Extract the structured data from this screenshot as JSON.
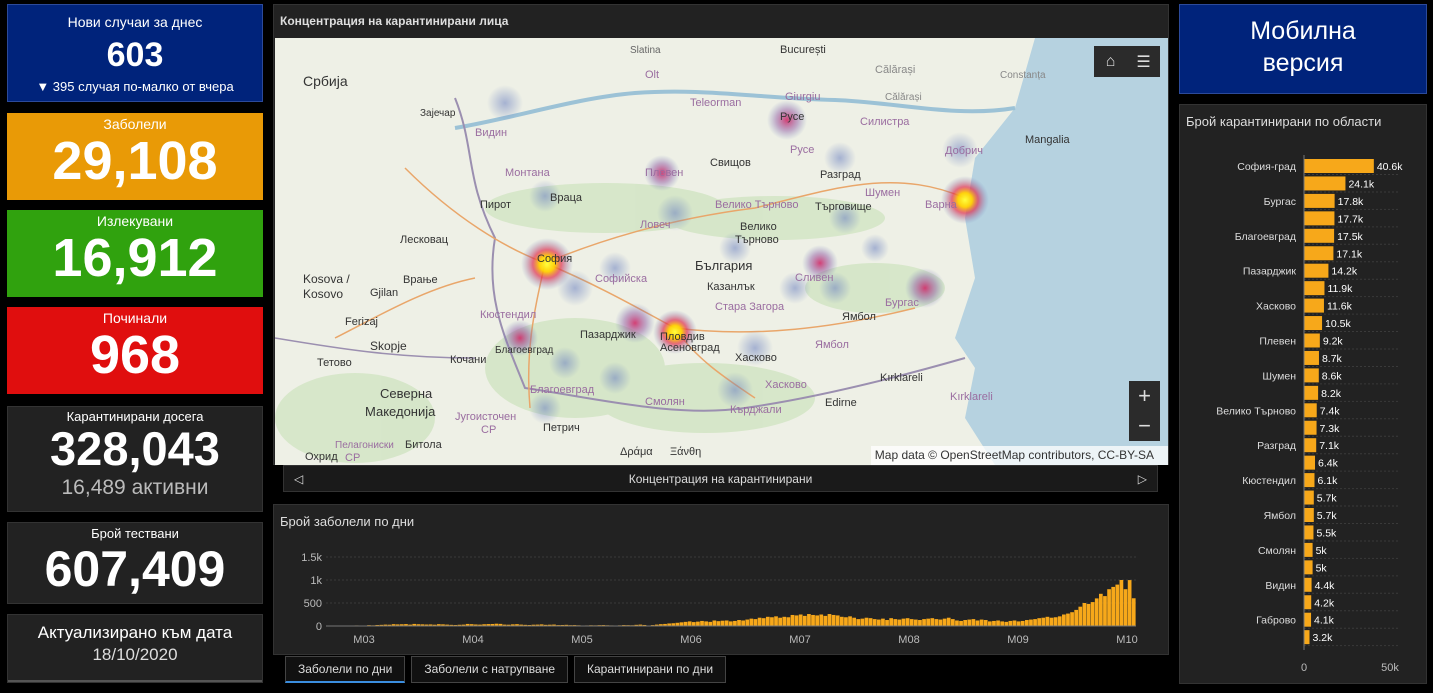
{
  "new_cases": {
    "label": "Нови случаи за днес",
    "value": "603",
    "delta": "▼ 395 случая по-малко от вчера"
  },
  "ill": {
    "label": "Заболели",
    "value": "29,108"
  },
  "recovered": {
    "label": "Излекувани",
    "value": "16,912"
  },
  "deceased": {
    "label": "Починали",
    "value": "968"
  },
  "quarantined": {
    "label": "Карантинирани досега",
    "value": "328,043",
    "active": "16,489 активни"
  },
  "tests": {
    "label": "Брой тествани",
    "value": "607,409"
  },
  "updated": {
    "label": "Актуализирано към дата",
    "date": "18/10/2020"
  },
  "mobile": {
    "line1": "Мобилна",
    "line2": "версия"
  },
  "map": {
    "title": "Концентрация на карантинирани лица",
    "attribution": "Map data © OpenStreetMap contributors, CC-BY-SA",
    "nav_label": "Концентрация на карантинирани",
    "home_icon": "home-icon",
    "list_icon": "list-icon",
    "zoom_in": "+",
    "zoom_out": "−",
    "labels": [
      {
        "t": "Slatina"
      },
      {
        "t": "București"
      },
      {
        "t": "Călărași"
      },
      {
        "t": "Constanța"
      },
      {
        "t": "Olt"
      },
      {
        "t": "Giurgiu"
      },
      {
        "t": "Teleorman"
      },
      {
        "t": "Călărași"
      },
      {
        "t": "Србија"
      },
      {
        "t": "Зајечар"
      },
      {
        "t": "Видин"
      },
      {
        "t": "Русе"
      },
      {
        "t": "Силистра"
      },
      {
        "t": "Mangalia"
      },
      {
        "t": "Добрич"
      },
      {
        "t": "Монтана"
      },
      {
        "t": "Плевен"
      },
      {
        "t": "Свищов"
      },
      {
        "t": "Русе"
      },
      {
        "t": "Разград"
      },
      {
        "t": "Шумен"
      },
      {
        "t": "Варна"
      },
      {
        "t": "Враца"
      },
      {
        "t": "Велико Търново"
      },
      {
        "t": "Търговище"
      },
      {
        "t": "Пирот"
      },
      {
        "t": "Ловеч"
      },
      {
        "t": "Велико"
      },
      {
        "t": "Търново"
      },
      {
        "t": "Лесковац"
      },
      {
        "t": "София"
      },
      {
        "t": "Софийска"
      },
      {
        "t": "България"
      },
      {
        "t": "Сливен"
      },
      {
        "t": "Казанлък"
      },
      {
        "t": "Стара Загора"
      },
      {
        "t": "Ямбол"
      },
      {
        "t": "Бургас"
      },
      {
        "t": "Врање"
      },
      {
        "t": "Kosova /"
      },
      {
        "t": "Kosovo"
      },
      {
        "t": "Gjilan"
      },
      {
        "t": "Кюстендил"
      },
      {
        "t": "Пазарджик"
      },
      {
        "t": "Пловдив"
      },
      {
        "t": "Асеновград"
      },
      {
        "t": "Хасково"
      },
      {
        "t": "Ямбол"
      },
      {
        "t": "Ferizaj"
      },
      {
        "t": "Skopje"
      },
      {
        "t": "Благоевград"
      },
      {
        "t": "Хасково"
      },
      {
        "t": "Kırklareli"
      },
      {
        "t": "Kırklareli"
      },
      {
        "t": "Тетово"
      },
      {
        "t": "Кочани"
      },
      {
        "t": "Благоевград"
      },
      {
        "t": "Смолян"
      },
      {
        "t": "Кърджали"
      },
      {
        "t": "Северна"
      },
      {
        "t": "Македонија"
      },
      {
        "t": "Edirne"
      },
      {
        "t": "Југоисточен"
      },
      {
        "t": "Петрич"
      },
      {
        "t": "Пелагониски"
      },
      {
        "t": "Охрид"
      },
      {
        "t": "Δράμα"
      },
      {
        "t": "Ξάνθη"
      },
      {
        "t": "Битола"
      },
      {
        "t": "CP"
      },
      {
        "t": "CP"
      }
    ]
  },
  "daily_chart": {
    "title": "Брой заболели по дни",
    "tabs": [
      "Заболели по дни",
      "Заболели с натрупване",
      "Карантинирани по дни"
    ],
    "chart_data": {
      "type": "bar",
      "title": "Брой заболели по дни",
      "x_ticks": [
        "M03",
        "M04",
        "M05",
        "M06",
        "M07",
        "M08",
        "M09",
        "M10"
      ],
      "y_ticks": [
        "0",
        "500",
        "1k",
        "1.5k"
      ],
      "ylim": [
        0,
        1500
      ],
      "color": "#f7a81a",
      "values": [
        4,
        2,
        1,
        3,
        4,
        8,
        5,
        12,
        10,
        7,
        18,
        14,
        22,
        25,
        30,
        28,
        40,
        35,
        38,
        42,
        30,
        45,
        38,
        36,
        32,
        34,
        28,
        40,
        36,
        30,
        25,
        22,
        27,
        30,
        45,
        40,
        33,
        30,
        38,
        42,
        44,
        50,
        46,
        30,
        28,
        36,
        40,
        30,
        25,
        22,
        28,
        30,
        35,
        25,
        28,
        31,
        20,
        22,
        25,
        18,
        20,
        15,
        10,
        12,
        16,
        14,
        18,
        20,
        15,
        12,
        10,
        14,
        20,
        18,
        16,
        25,
        30,
        22,
        10,
        20,
        30,
        40,
        45,
        55,
        60,
        70,
        80,
        90,
        100,
        85,
        95,
        110,
        100,
        90,
        120,
        105,
        115,
        120,
        100,
        110,
        130,
        120,
        140,
        160,
        150,
        180,
        170,
        200,
        190,
        210,
        180,
        200,
        190,
        240,
        230,
        250,
        220,
        260,
        240,
        230,
        250,
        220,
        260,
        240,
        230,
        200,
        190,
        210,
        180,
        150,
        160,
        180,
        170,
        150,
        140,
        160,
        130,
        170,
        150,
        140,
        160,
        170,
        150,
        140,
        130,
        150,
        160,
        170,
        150,
        140,
        160,
        180,
        150,
        120,
        110,
        130,
        140,
        150,
        120,
        140,
        130,
        100,
        110,
        120,
        100,
        90,
        110,
        120,
        100,
        110,
        130,
        140,
        150,
        170,
        180,
        200,
        180,
        190,
        210,
        250,
        270,
        300,
        350,
        420,
        500,
        480,
        520,
        600,
        700,
        650,
        800,
        850,
        900,
        1000,
        800,
        998,
        603
      ]
    }
  },
  "region_chart": {
    "title": "Брой карантинирани по области",
    "chart_data": {
      "type": "bar",
      "orientation": "horizontal",
      "title": "Брой карантинирани по области",
      "color": "#f7a81a",
      "xlim": [
        0,
        50000
      ],
      "x_ticks": [
        "0",
        "50k"
      ],
      "categories": [
        "София-град",
        "",
        "Бургас",
        "",
        "Благоевград",
        "",
        "Пазарджик",
        "",
        "Хасково",
        "",
        "Плевен",
        "",
        "Шумен",
        "",
        "Велико Търново",
        "",
        "Разград",
        "",
        "Кюстендил",
        "",
        "Ямбол",
        "",
        "Смолян",
        "",
        "Видин",
        "",
        "Габрово",
        ""
      ],
      "values": [
        40600,
        24100,
        17800,
        17700,
        17500,
        17100,
        14200,
        11900,
        11600,
        10500,
        9200,
        8700,
        8600,
        8200,
        7400,
        7300,
        7100,
        6400,
        6100,
        5700,
        5700,
        5500,
        5000,
        5000,
        4400,
        4200,
        4100,
        3200
      ],
      "data_labels": [
        "40.6k",
        "24.1k",
        "17.8k",
        "17.7k",
        "17.5k",
        "17.1k",
        "14.2k",
        "11.9k",
        "11.6k",
        "10.5k",
        "9.2k",
        "8.7k",
        "8.6k",
        "8.2k",
        "7.4k",
        "7.3k",
        "7.1k",
        "6.4k",
        "6.1k",
        "5.7k",
        "5.7k",
        "5.5k",
        "5k",
        "5k",
        "4.4k",
        "4.2k",
        "4.1k",
        "3.2k"
      ]
    }
  }
}
